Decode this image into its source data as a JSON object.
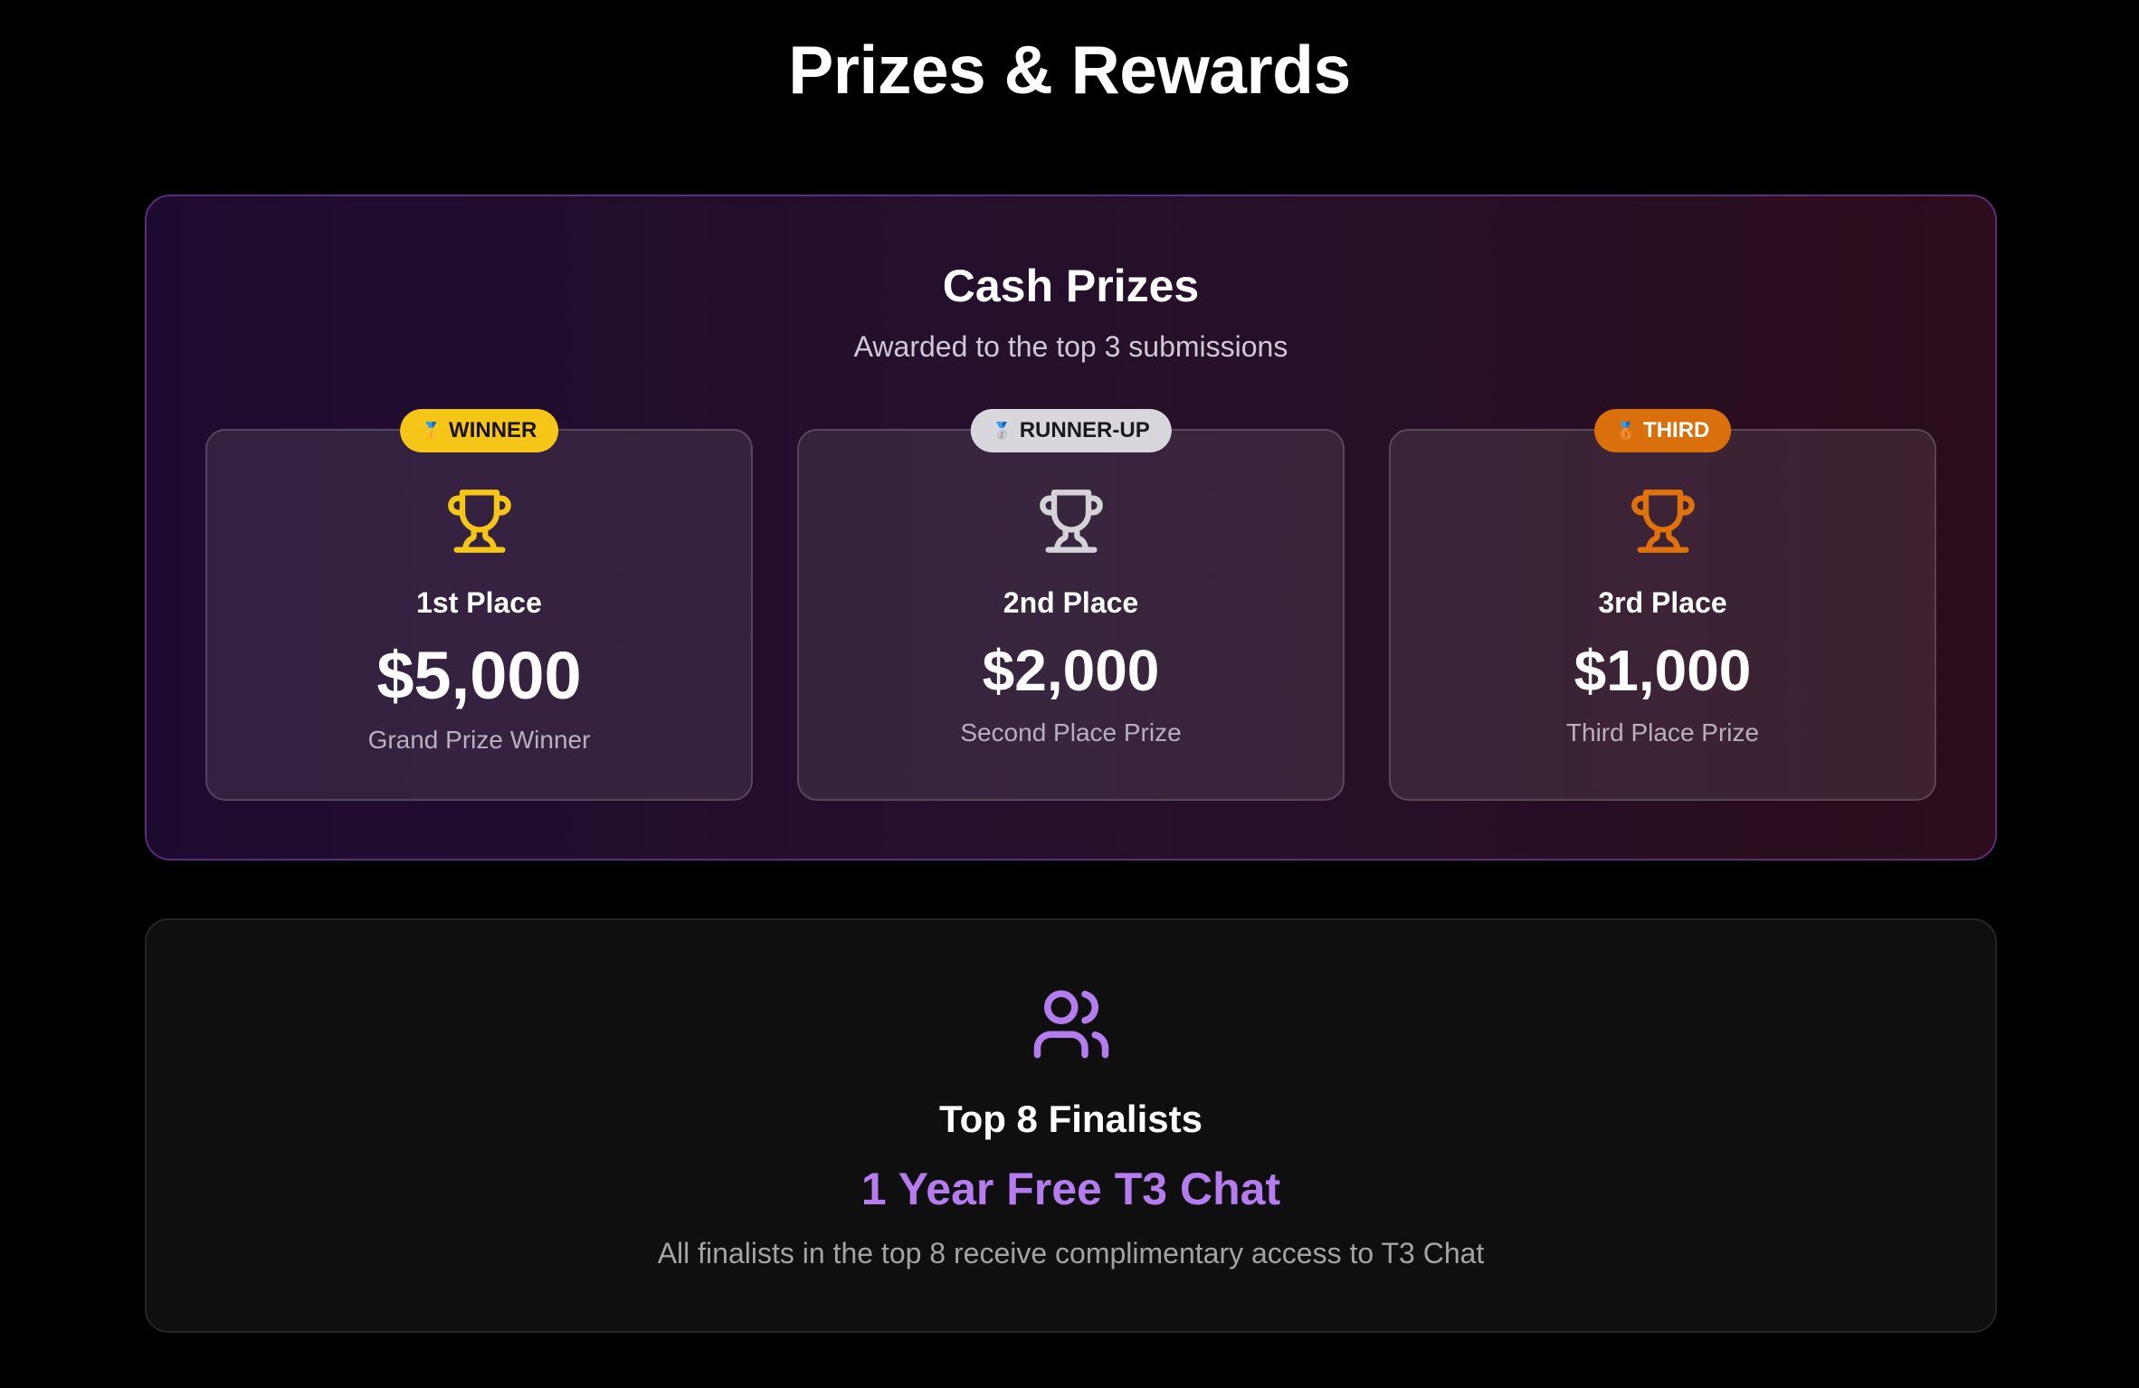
{
  "page": {
    "title": "Prizes & Rewards"
  },
  "cash_prizes": {
    "title": "Cash Prizes",
    "subtitle": "Awarded to the top 3 submissions",
    "cards": [
      {
        "badge_label": "WINNER",
        "badge_icon": "gold-medal-icon",
        "badge_color": "#f5c518",
        "trophy_color": "#f5c518",
        "place": "1st Place",
        "amount": "$5,000",
        "description": "Grand Prize Winner"
      },
      {
        "badge_label": "RUNNER-UP",
        "badge_icon": "silver-medal-icon",
        "badge_color": "#d8d8dc",
        "trophy_color": "#d4d4d8",
        "place": "2nd Place",
        "amount": "$2,000",
        "description": "Second Place Prize"
      },
      {
        "badge_label": "THIRD",
        "badge_icon": "bronze-medal-icon",
        "badge_color": "#d9700b",
        "trophy_color": "#e0720c",
        "place": "3rd Place",
        "amount": "$1,000",
        "description": "Third Place Prize"
      }
    ]
  },
  "finalists": {
    "icon": "users-icon",
    "icon_color": "#b57cf0",
    "title": "Top 8 Finalists",
    "reward": "1 Year Free T3 Chat",
    "description": "All finalists in the top 8 receive complimentary access to T3 Chat"
  }
}
